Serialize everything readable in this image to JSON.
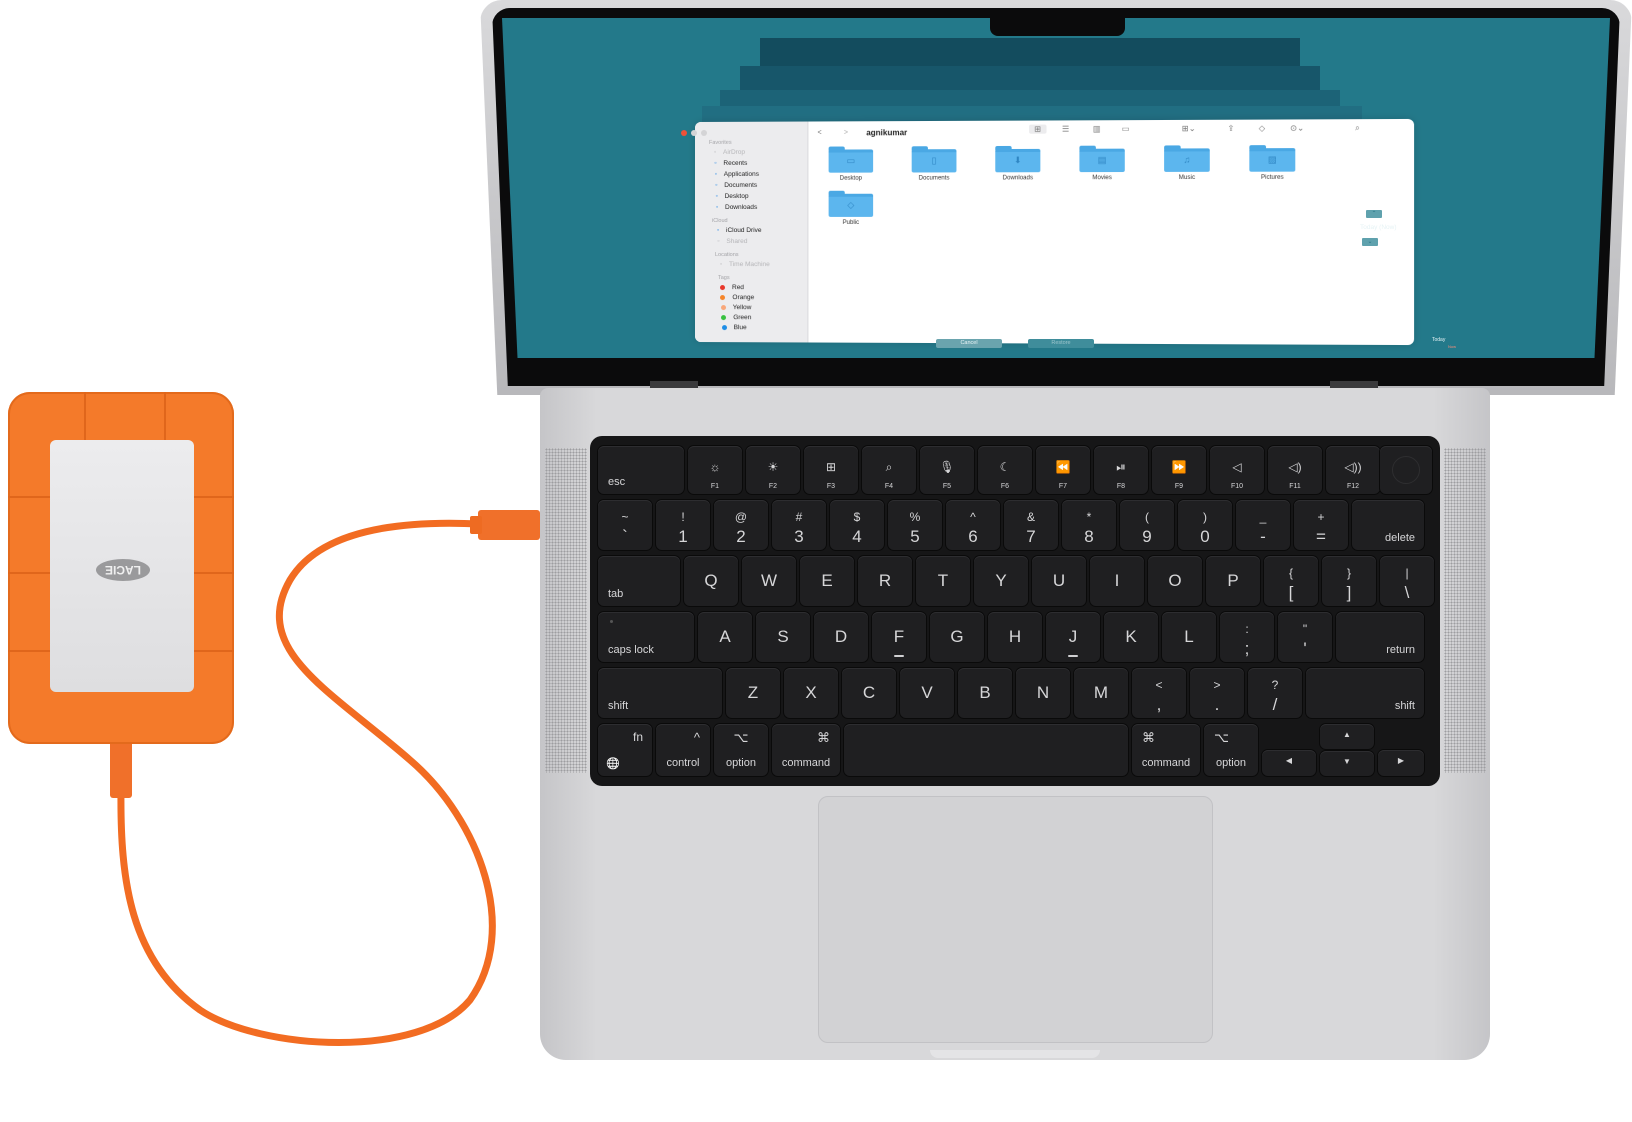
{
  "scene": {
    "device": "MacBook Pro",
    "external_drive": {
      "brand_logo": "LACIE",
      "color": "#f47a2a"
    }
  },
  "colors": {
    "desktop_bg": "#23798a",
    "folder_blue": "#5cb6ee",
    "accent_orange": "#f47a2a",
    "key_bg": "#1f1f21"
  },
  "finder": {
    "title": "agnikumar",
    "nav": {
      "back": "<",
      "forward": ">"
    },
    "toolbar_icons": [
      "icon-view-icon",
      "list-view-icon",
      "column-view-icon",
      "gallery-view-icon",
      "group-icon",
      "share-icon",
      "tag-icon",
      "more-icon",
      "search-icon"
    ],
    "sidebar": {
      "sections": [
        {
          "header": "Favorites",
          "items": [
            {
              "label": "AirDrop",
              "icon": "airdrop-icon",
              "dimmed": true
            },
            {
              "label": "Recents",
              "icon": "clock-icon"
            },
            {
              "label": "Applications",
              "icon": "applications-icon"
            },
            {
              "label": "Documents",
              "icon": "document-icon"
            },
            {
              "label": "Desktop",
              "icon": "desktop-icon"
            },
            {
              "label": "Downloads",
              "icon": "download-icon"
            }
          ]
        },
        {
          "header": "iCloud",
          "items": [
            {
              "label": "iCloud Drive",
              "icon": "cloud-icon"
            },
            {
              "label": "Shared",
              "icon": "shared-folder-icon",
              "dimmed": true
            }
          ]
        },
        {
          "header": "Locations",
          "items": [
            {
              "label": "Time Machine",
              "icon": "time-machine-icon",
              "dimmed": true
            }
          ]
        },
        {
          "header": "Tags",
          "items": [
            {
              "label": "Red",
              "color": "#e8382b"
            },
            {
              "label": "Orange",
              "color": "#f5852a"
            },
            {
              "label": "Yellow",
              "color": "#f8a77a"
            },
            {
              "label": "Green",
              "color": "#37c13f"
            },
            {
              "label": "Blue",
              "color": "#1e8ee6"
            }
          ]
        }
      ]
    },
    "folders": [
      {
        "label": "Desktop",
        "glyph": "▭"
      },
      {
        "label": "Documents",
        "glyph": "▯"
      },
      {
        "label": "Downloads",
        "glyph": "⬇"
      },
      {
        "label": "Movies",
        "glyph": "▤"
      },
      {
        "label": "Music",
        "glyph": "♫"
      },
      {
        "label": "Pictures",
        "glyph": "▨"
      },
      {
        "label": "Public",
        "glyph": "◇"
      }
    ],
    "dialog_buttons": {
      "cancel": "Cancel",
      "restore": "Restore"
    }
  },
  "time_machine": {
    "up_arrow": "⌃",
    "down_arrow": "⌄",
    "current_label": "Today (Now)",
    "timeline_label": "Today",
    "timeline_sub": "Now"
  },
  "keyboard": {
    "function_row": [
      {
        "label": "esc"
      },
      {
        "label": "F1",
        "icon": "☼",
        "icon_name": "brightness-down-icon"
      },
      {
        "label": "F2",
        "icon": "☀",
        "icon_name": "brightness-up-icon"
      },
      {
        "label": "F3",
        "icon": "⊞",
        "icon_name": "mission-control-icon"
      },
      {
        "label": "F4",
        "icon": "⌕",
        "icon_name": "spotlight-search-icon"
      },
      {
        "label": "F5",
        "icon": "🎙",
        "icon_name": "dictation-icon"
      },
      {
        "label": "F6",
        "icon": "☾",
        "icon_name": "do-not-disturb-icon"
      },
      {
        "label": "F7",
        "icon": "⏪",
        "icon_name": "rewind-icon"
      },
      {
        "label": "F8",
        "icon": "⏯",
        "icon_name": "play-pause-icon"
      },
      {
        "label": "F9",
        "icon": "⏩",
        "icon_name": "fast-forward-icon"
      },
      {
        "label": "F10",
        "icon": "◁",
        "icon_name": "mute-icon"
      },
      {
        "label": "F11",
        "icon": "◁)",
        "icon_name": "volume-down-icon"
      },
      {
        "label": "F12",
        "icon": "◁))",
        "icon_name": "volume-up-icon"
      }
    ],
    "number_row": [
      {
        "up": "~",
        "lo": "`"
      },
      {
        "up": "!",
        "lo": "1"
      },
      {
        "up": "@",
        "lo": "2"
      },
      {
        "up": "#",
        "lo": "3"
      },
      {
        "up": "$",
        "lo": "4"
      },
      {
        "up": "%",
        "lo": "5"
      },
      {
        "up": "^",
        "lo": "6"
      },
      {
        "up": "&",
        "lo": "7"
      },
      {
        "up": "*",
        "lo": "8"
      },
      {
        "up": "(",
        "lo": "9"
      },
      {
        "up": ")",
        "lo": "0"
      },
      {
        "up": "_",
        "lo": "-"
      },
      {
        "up": "+",
        "lo": "="
      },
      {
        "label": "delete"
      }
    ],
    "qwerty_row": [
      {
        "label": "tab"
      },
      {
        "k": "Q"
      },
      {
        "k": "W"
      },
      {
        "k": "E"
      },
      {
        "k": "R"
      },
      {
        "k": "T"
      },
      {
        "k": "Y"
      },
      {
        "k": "U"
      },
      {
        "k": "I"
      },
      {
        "k": "O"
      },
      {
        "k": "P"
      },
      {
        "up": "{",
        "lo": "["
      },
      {
        "up": "}",
        "lo": "]"
      },
      {
        "up": "|",
        "lo": "\\"
      }
    ],
    "home_row": [
      {
        "label": "caps lock"
      },
      {
        "k": "A"
      },
      {
        "k": "S"
      },
      {
        "k": "D"
      },
      {
        "k": "F"
      },
      {
        "k": "G"
      },
      {
        "k": "H"
      },
      {
        "k": "J"
      },
      {
        "k": "K"
      },
      {
        "k": "L"
      },
      {
        "up": ":",
        "lo": ";"
      },
      {
        "up": "\"",
        "lo": "'"
      },
      {
        "label": "return"
      }
    ],
    "shift_row": [
      {
        "label": "shift"
      },
      {
        "k": "Z"
      },
      {
        "k": "X"
      },
      {
        "k": "C"
      },
      {
        "k": "V"
      },
      {
        "k": "B"
      },
      {
        "k": "N"
      },
      {
        "k": "M"
      },
      {
        "up": "<",
        "lo": ","
      },
      {
        "up": ">",
        "lo": "."
      },
      {
        "up": "?",
        "lo": "/"
      },
      {
        "label": "shift"
      }
    ],
    "bottom_row": {
      "fn": "fn",
      "globe": "🌐",
      "control": {
        "symbol": "^",
        "label": "control"
      },
      "option_l": {
        "symbol": "⌥",
        "label": "option"
      },
      "command_l": {
        "symbol": "⌘",
        "label": "command"
      },
      "command_r": {
        "symbol": "⌘",
        "label": "command"
      },
      "option_r": {
        "symbol": "⌥",
        "label": "option"
      },
      "arrows": {
        "up": "▲",
        "down": "▼",
        "left": "◀",
        "right": "▶"
      }
    }
  }
}
